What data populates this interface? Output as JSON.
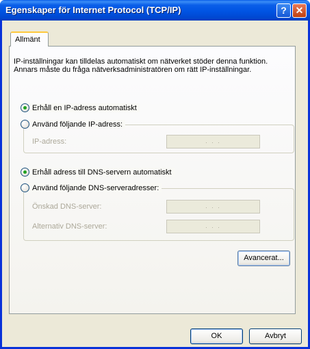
{
  "window": {
    "title": "Egenskaper för Internet Protocol (TCP/IP)",
    "help_button": "?",
    "close_button": "✕"
  },
  "tabs": [
    {
      "label": "Allmänt",
      "selected": true
    }
  ],
  "description": "IP-inställningar kan tilldelas automatiskt om nätverket stöder denna funktion. Annars måste du fråga nätverksadministratören om rätt IP-inställningar.",
  "ip": {
    "auto_option": "Erhåll en IP-adress automatiskt",
    "manual_option": "Använd följande IP-adress:",
    "selected": "auto",
    "address_label": "IP-adress:",
    "address_value": ". . ."
  },
  "dns": {
    "auto_option": "Erhåll adress till DNS-servern automatiskt",
    "manual_option": "Använd följande DNS-serveradresser:",
    "selected": "auto",
    "preferred_label": "Önskad DNS-server:",
    "preferred_value": ". . .",
    "alternate_label": "Alternativ DNS-server:",
    "alternate_value": ". . ."
  },
  "buttons": {
    "advanced": "Avancerat...",
    "ok": "OK",
    "cancel": "Avbryt"
  }
}
